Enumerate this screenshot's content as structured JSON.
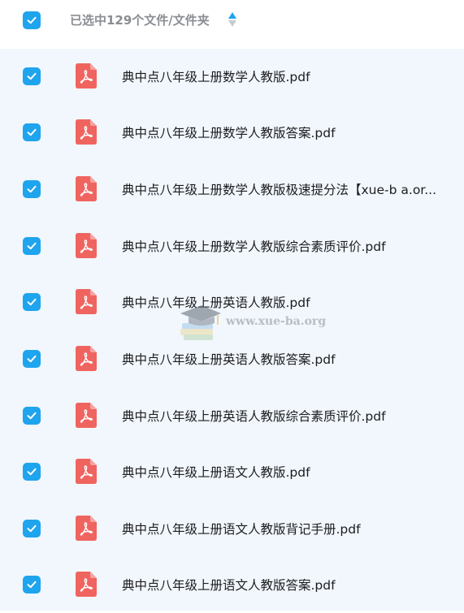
{
  "header": {
    "select_all_checked": true,
    "selection_text": "已选中129个文件/文件夹",
    "sort_icon": "sort-up-down-icon"
  },
  "files": [
    {
      "name": "典中点八年级上册数学人教版.pdf",
      "checked": true,
      "icon": "pdf-file-icon"
    },
    {
      "name": "典中点八年级上册数学人教版答案.pdf",
      "checked": true,
      "icon": "pdf-file-icon"
    },
    {
      "name": "典中点八年级上册数学人教版极速提分法【xue-b a.or...",
      "checked": true,
      "icon": "pdf-file-icon"
    },
    {
      "name": "典中点八年级上册数学人教版综合素质评价.pdf",
      "checked": true,
      "icon": "pdf-file-icon"
    },
    {
      "name": "典中点八年级上册英语人教版.pdf",
      "checked": true,
      "icon": "pdf-file-icon"
    },
    {
      "name": "典中点八年级上册英语人教版答案.pdf",
      "checked": true,
      "icon": "pdf-file-icon"
    },
    {
      "name": "典中点八年级上册英语人教版综合素质评价.pdf",
      "checked": true,
      "icon": "pdf-file-icon"
    },
    {
      "name": "典中点八年级上册语文人教版.pdf",
      "checked": true,
      "icon": "pdf-file-icon"
    },
    {
      "name": "典中点八年级上册语文人教版背记手册.pdf",
      "checked": true,
      "icon": "pdf-file-icon"
    },
    {
      "name": "典中点八年级上册语文人教版答案.pdf",
      "checked": true,
      "icon": "pdf-file-icon"
    }
  ],
  "watermark": {
    "text": "www.xue-ba.org"
  },
  "colors": {
    "accent": "#1fa4ee",
    "pdf_red": "#f0645f",
    "list_bg": "#f1f7fd"
  }
}
